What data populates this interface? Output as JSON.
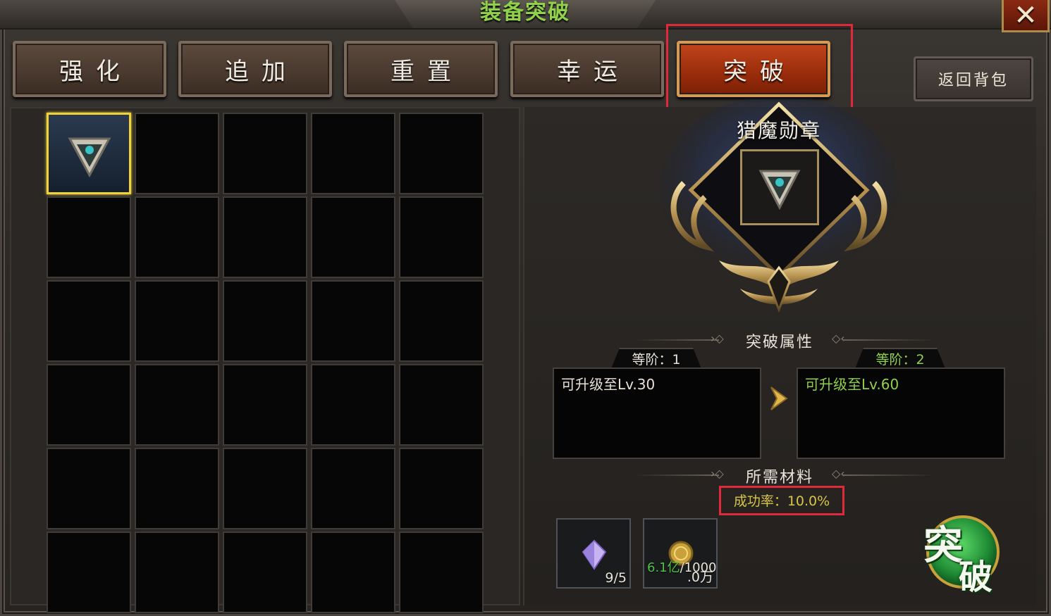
{
  "window": {
    "title": "装备突破",
    "close_label": "✕"
  },
  "tabs": [
    {
      "label": "强化",
      "active": false
    },
    {
      "label": "追加",
      "active": false
    },
    {
      "label": "重置",
      "active": false
    },
    {
      "label": "幸运",
      "active": false
    },
    {
      "label": "突破",
      "active": true
    }
  ],
  "back_button": {
    "label": "返回背包"
  },
  "inventory": {
    "columns": 5,
    "rows": 6,
    "selected_slot": 0
  },
  "item": {
    "name": "猎魔勋章",
    "icon": "medal-icon"
  },
  "breakthrough_attributes": {
    "section_title": "突破属性",
    "current": {
      "tier_label": "等阶：1",
      "description": "可升级至Lv.30"
    },
    "next": {
      "tier_label": "等阶：2",
      "description": "可升级至Lv.60"
    }
  },
  "materials": {
    "section_title": "所需材料",
    "success_rate": "成功率：10.0%",
    "items": [
      {
        "icon": "crystal-icon",
        "count": "9/5"
      },
      {
        "icon": "gold-coin-icon",
        "have": "6.1亿",
        "need": "/1000",
        "need_unit": ".0万"
      }
    ]
  },
  "action_button": {
    "label_top": "突",
    "label_bottom": "破"
  },
  "colors": {
    "title_green": "#8fd14a",
    "active_tab": "#c1451c",
    "highlight_red": "#e0293a",
    "next_tier_green": "#8fd14a",
    "current_tier_text": "#e8e2d6",
    "selected_slot_border": "#f0d33a"
  }
}
